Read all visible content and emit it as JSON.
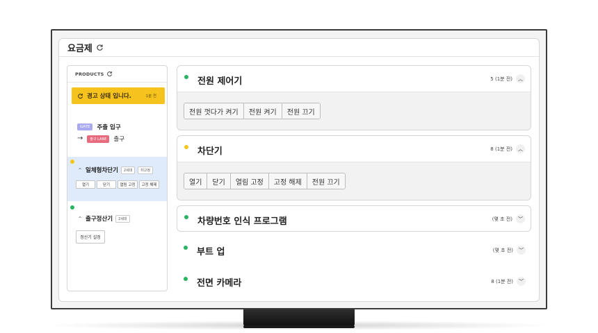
{
  "app": {
    "title": "요금제"
  },
  "products": {
    "header": "PRODUCTS",
    "warning": {
      "text": "경고 상태 입니다.",
      "time": "1분 전"
    },
    "gate": {
      "badge": "GATE",
      "name": "주출 입구"
    },
    "lane": {
      "badge": "출구 LANE",
      "name": "출구"
    },
    "devices": [
      {
        "name": "일체형차단기",
        "count": "2세대",
        "status": "미고정",
        "status_color": "#f5c518",
        "buttons": [
          "열기",
          "닫기",
          "열림 고정",
          "고정 해제"
        ]
      },
      {
        "name": "출구정산기",
        "count": "2세대",
        "status_color": "#28b463",
        "buttons": [
          "정산기 설정"
        ]
      }
    ]
  },
  "cards": [
    {
      "title": "전원 제어기",
      "meta": "5 (1분 전)",
      "dot_color": "#28b463",
      "expanded": true,
      "buttons": [
        "전원 껏다가 켜기",
        "전원 켜기",
        "전원 끄기"
      ]
    },
    {
      "title": "차단기",
      "meta": "8 (1분 전)",
      "dot_color": "#f5c518",
      "expanded": true,
      "buttons": [
        "열기",
        "닫기",
        "열림 고정",
        "고정 해제",
        "전원 끄기"
      ]
    },
    {
      "title": "차량번호 인식 프로그램",
      "meta": "(몇 초 전)",
      "dot_color": "#28b463",
      "expanded": false
    },
    {
      "title": "부트 업",
      "meta": "(몇 초 전)",
      "dot_color": "#28b463",
      "expanded": false
    },
    {
      "title": "전면 카메라",
      "meta": "8 (1분 전)",
      "dot_color": "#28b463",
      "expanded": false
    }
  ],
  "icons": {
    "refresh": "refresh-icon",
    "chevron_up": "chevron-up-icon",
    "chevron_down": "chevron-down-icon",
    "arrow": "arrow-right-icon"
  }
}
